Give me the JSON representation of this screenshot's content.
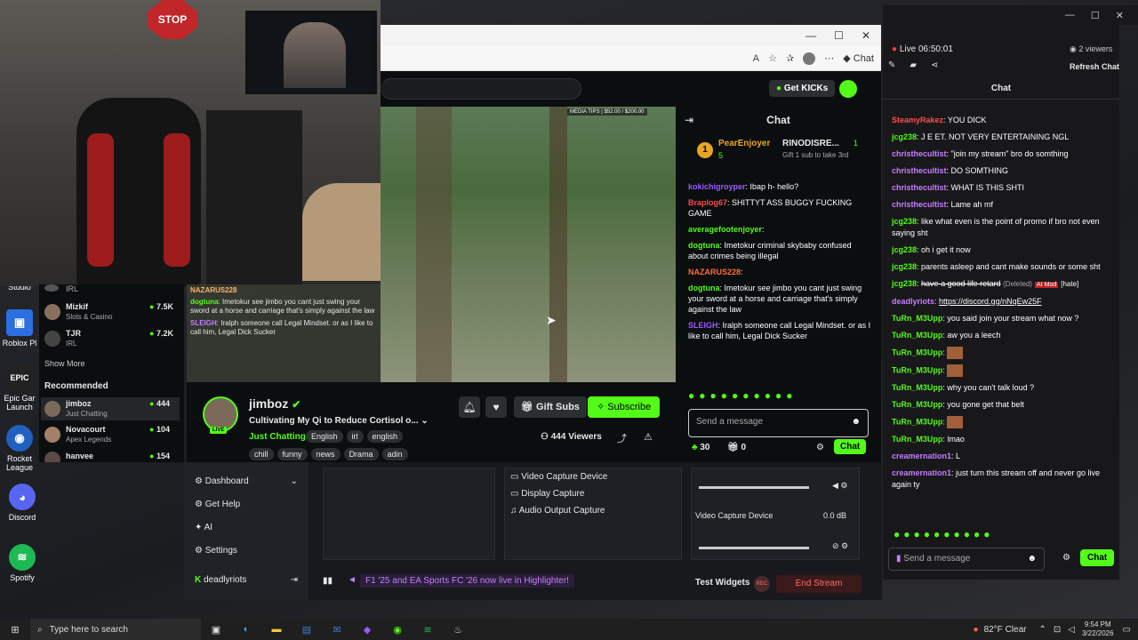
{
  "desktop": {
    "icons": [
      {
        "label": "Studio",
        "name": "studio-desktop-icon",
        "color": "#2d6ee0"
      },
      {
        "label": "Roblox Pl",
        "name": "roblox-desktop-icon",
        "color": "#2d6ee0"
      },
      {
        "label": "Epic Gar Launch",
        "name": "epic-desktop-icon",
        "color": "#333"
      },
      {
        "label": "Rocket League",
        "name": "rocket-league-desktop-icon",
        "color": "#2060c0"
      },
      {
        "label": "Discord",
        "name": "discord-desktop-icon",
        "color": "#5865f2"
      },
      {
        "label": "Spotify",
        "name": "spotify-desktop-icon",
        "color": "#1db954"
      }
    ]
  },
  "kick": {
    "get_kicks": "Get KICKs",
    "chat_title": "Chat",
    "leader": {
      "rank": "1",
      "name": "PearEnjoyer",
      "count": "5",
      "name2": "RINODISRE...",
      "count2": "1",
      "gift_hint": "Gift 1 sub to take 3rd"
    },
    "messages": [
      {
        "user": "kokichigroyper",
        "text": "Ibap h- hello?",
        "color": "#9b59ff"
      },
      {
        "user": "Braplog67",
        "text": "SHITTYT ASS BUGGY FUCKING GAME",
        "color": "#ff4b4b"
      },
      {
        "user": "averagefootenjoyer",
        "text": "",
        "color": "#53fc18"
      },
      {
        "user": "dogtuna",
        "text": "Imetokur criminal skybaby confused about crimes being illegal",
        "color": "#53fc18"
      },
      {
        "user": "NAZARUS228",
        "text": "",
        "color": "#ff6b3d"
      },
      {
        "user": "dogtuna",
        "text": "Imetokur see jimbo you cant just swing your sword at a horse and carriage that's simply against the law",
        "color": "#53fc18"
      },
      {
        "user": "SLEIGH",
        "text": "Iralph someone call Legal Mindset. or as I like to call him, Legal Dick Sucker",
        "color": "#9b59ff"
      }
    ],
    "send_placeholder": "Send a message",
    "points": "30",
    "gift_count": "0",
    "chat_button": "Chat",
    "streamer": "jimboz",
    "stream_title": "Cultivating My Qi to Reduce Cortisol o...",
    "category": "Just Chatting",
    "tags_row1": [
      "English",
      "irl",
      "english"
    ],
    "tags_row2": [
      "chill",
      "funny",
      "news",
      "Drama",
      "adin"
    ],
    "live_badge": "LIVE",
    "gift_subs": "Gift Subs",
    "subscribe": "Subscribe",
    "viewers": "444 Viewers",
    "sidebar": {
      "items_top": [
        {
          "name": "IRL",
          "sub": ""
        },
        {
          "name": "Mizkif",
          "sub": "Slots & Casino",
          "count": "7.5K"
        },
        {
          "name": "TJR",
          "sub": "IRL",
          "count": "7.2K"
        }
      ],
      "show_more": "Show More",
      "recommended": "Recommended",
      "items_rec": [
        {
          "name": "jimboz",
          "sub": "Just Chatting",
          "count": "444"
        },
        {
          "name": "Novacourt",
          "sub": "Apex Legends",
          "count": "104"
        },
        {
          "name": "hanvee",
          "sub": "",
          "count": "154"
        }
      ]
    },
    "overlay": {
      "user0": "NAZARUS228",
      "msg1_user": "dogtuna",
      "msg1": "Imetokur see jimbo you cant just swing your sword at a horse and carriage that's simply against the law",
      "msg2_user": "SLEIGH",
      "msg2": "Iralph someone call Legal Mindset. or as I like to call him, Legal Dick Sucker"
    },
    "hud": "MEDIA TIPS | $52.00 / $200.00"
  },
  "right_chat": {
    "status": "Live 06:50:01",
    "viewers": "2 viewers",
    "refresh": "Refresh Chat",
    "title": "Chat",
    "messages": [
      {
        "user": "SteamyRakez",
        "text": "YOU DICK",
        "color": "#ff4b4b"
      },
      {
        "user": "jcg238",
        "text": "J E ET. NOT VERY ENTERTAINING NGL",
        "color": "#53fc18"
      },
      {
        "user": "christhecultist",
        "text": "\"join my stream\" bro do somthing",
        "color": "#c77dff"
      },
      {
        "user": "christhecultist",
        "text": "DO SOMTHING",
        "color": "#c77dff"
      },
      {
        "user": "christhecultist",
        "text": "WHAT IS THIS SHTI",
        "color": "#c77dff"
      },
      {
        "user": "christhecultist",
        "text": "Lame ah mf",
        "color": "#c77dff"
      },
      {
        "user": "jcg238",
        "text": "like what even is the point of promo if bro not even saying sht",
        "color": "#53fc18"
      },
      {
        "user": "jcg238",
        "text": "oh i get it now",
        "color": "#53fc18"
      },
      {
        "user": "jcg238",
        "text": "parents asleep and cant make sounds or some sht",
        "color": "#53fc18"
      },
      {
        "user": "jcg238",
        "text": "have a good life retard",
        "color": "#53fc18",
        "deleted": "(Deleted)",
        "ai": "AI Mod",
        "hate": "[hate]"
      },
      {
        "user": "deadlyriots",
        "text": "https://discord.gg/nNqEw25F",
        "color": "#c77dff",
        "link": true
      },
      {
        "user": "TuRn_M3Upp",
        "text": "you said join your stream what now ?",
        "color": "#53fc18"
      },
      {
        "user": "TuRn_M3Upp",
        "text": "aw you a leech",
        "color": "#53fc18"
      },
      {
        "user": "TuRn_M3Upp",
        "text": "",
        "color": "#53fc18",
        "emote": true
      },
      {
        "user": "TuRn_M3Upp",
        "text": "",
        "color": "#53fc18",
        "emote": true
      },
      {
        "user": "TuRn_M3Upp",
        "text": "why you can't talk loud ?",
        "color": "#53fc18"
      },
      {
        "user": "TuRn_M3Upp",
        "text": "you gone get that belt",
        "color": "#53fc18"
      },
      {
        "user": "TuRn_M3Upp",
        "text": "",
        "color": "#53fc18",
        "emote": true
      },
      {
        "user": "TuRn_M3Upp",
        "text": "lmao",
        "color": "#53fc18"
      },
      {
        "user": "creamernation1",
        "text": "L",
        "color": "#c77dff"
      },
      {
        "user": "creamernation1",
        "text": "just turn this stream off and never go live again ty",
        "color": "#c77dff"
      }
    ],
    "placeholder": "Send a message",
    "chat_button": "Chat"
  },
  "obs": {
    "menu": [
      "Dashboard",
      "Get Help",
      "AI",
      "Settings"
    ],
    "user": "deadlyriots",
    "sources": [
      "Video Capture Device",
      "Display Capture",
      "Audio Output Capture"
    ],
    "mixer_label": "Video Capture Device",
    "mixer_db": "0.0 dB",
    "ticker": "F1 '25 and EA Sports FC '26 now live in Highlighter!",
    "test_widgets": "Test Widgets",
    "rec": "REC",
    "end_stream": "End Stream"
  },
  "taskbar": {
    "search": "Type here to search",
    "weather": "82°F  Clear",
    "time": "9:54 PM",
    "date": "3/22/2026"
  },
  "colors": {
    "kick_green": "#53fc18",
    "bg": "#0b0e0f"
  }
}
